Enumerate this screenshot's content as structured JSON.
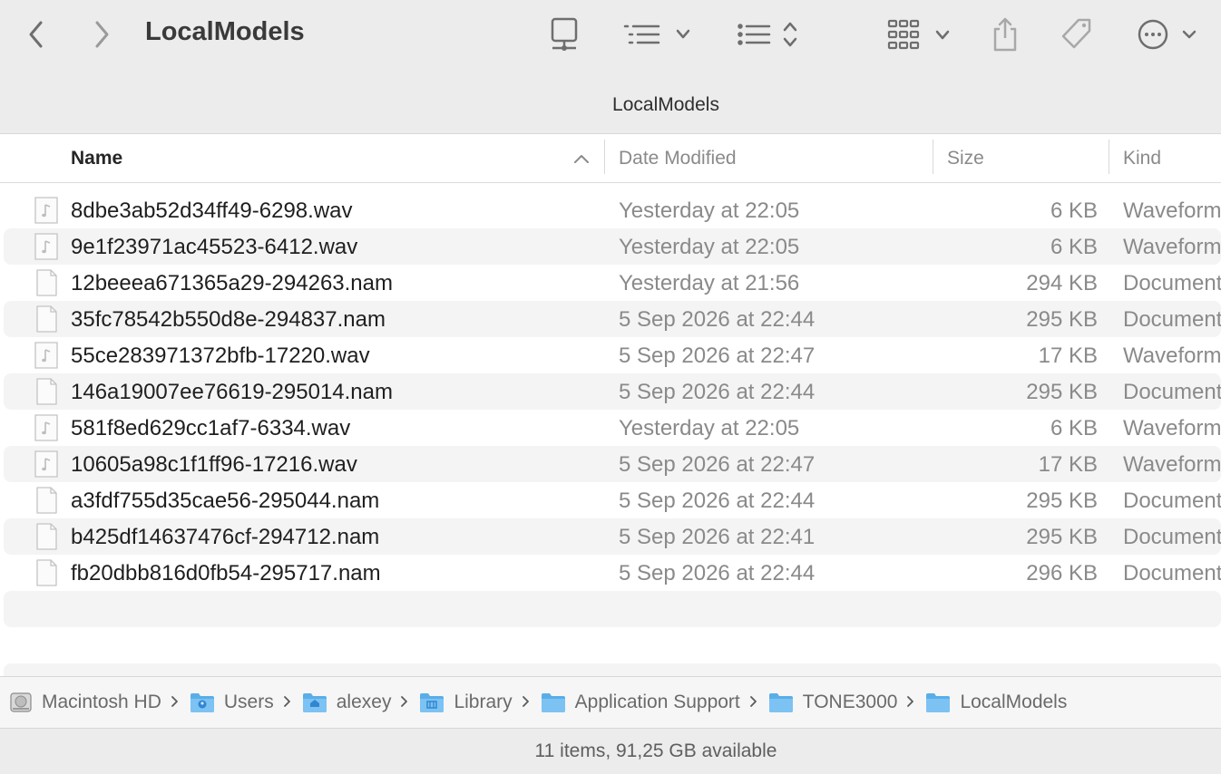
{
  "window": {
    "title": "LocalModels",
    "path_title": "LocalModels"
  },
  "toolbar": {
    "back_icon": "chevron-left-icon",
    "forward_icon": "chevron-right-icon",
    "items": [
      {
        "name": "server-icon"
      },
      {
        "name": "group-menu-icon"
      },
      {
        "name": "view-list-icon"
      },
      {
        "name": "gallery-view-icon"
      },
      {
        "name": "share-icon"
      },
      {
        "name": "tag-icon"
      },
      {
        "name": "more-actions-icon"
      }
    ]
  },
  "columns": {
    "name": "Name",
    "date": "Date Modified",
    "size": "Size",
    "kind": "Kind"
  },
  "files": [
    {
      "name": "8dbe3ab52d34ff49-6298.wav",
      "date": "Yesterday at 22:05",
      "size": "6 KB",
      "kind": "Waveform",
      "type": "audio"
    },
    {
      "name": "9e1f23971ac45523-6412.wav",
      "date": "Yesterday at 22:05",
      "size": "6 KB",
      "kind": "Waveform",
      "type": "audio"
    },
    {
      "name": "12beeea671365a29-294263.nam",
      "date": "Yesterday at 21:56",
      "size": "294 KB",
      "kind": "Document",
      "type": "doc"
    },
    {
      "name": "35fc78542b550d8e-294837.nam",
      "date": "5 Sep 2026 at 22:44",
      "size": "295 KB",
      "kind": "Document",
      "type": "doc"
    },
    {
      "name": "55ce283971372bfb-17220.wav",
      "date": "5 Sep 2026 at 22:47",
      "size": "17 KB",
      "kind": "Waveform",
      "type": "audio"
    },
    {
      "name": "146a19007ee76619-295014.nam",
      "date": "5 Sep 2026 at 22:44",
      "size": "295 KB",
      "kind": "Document",
      "type": "doc"
    },
    {
      "name": "581f8ed629cc1af7-6334.wav",
      "date": "Yesterday at 22:05",
      "size": "6 KB",
      "kind": "Waveform",
      "type": "audio"
    },
    {
      "name": "10605a98c1f1ff96-17216.wav",
      "date": "5 Sep 2026 at 22:47",
      "size": "17 KB",
      "kind": "Waveform",
      "type": "audio"
    },
    {
      "name": "a3fdf755d35cae56-295044.nam",
      "date": "5 Sep 2026 at 22:44",
      "size": "295 KB",
      "kind": "Document",
      "type": "doc"
    },
    {
      "name": "b425df14637476cf-294712.nam",
      "date": "5 Sep 2026 at 22:41",
      "size": "295 KB",
      "kind": "Document",
      "type": "doc"
    },
    {
      "name": "fb20dbb816d0fb54-295717.nam",
      "date": "5 Sep 2026 at 22:44",
      "size": "296 KB",
      "kind": "Document",
      "type": "doc"
    }
  ],
  "pathbar": [
    {
      "label": "Macintosh HD",
      "icon": "hard-drive-icon"
    },
    {
      "label": "Users",
      "icon": "users-folder-icon"
    },
    {
      "label": "alexey",
      "icon": "home-folder-icon"
    },
    {
      "label": "Library",
      "icon": "library-folder-icon"
    },
    {
      "label": "Application Support",
      "icon": "folder-icon"
    },
    {
      "label": "TONE3000",
      "icon": "folder-icon"
    },
    {
      "label": "LocalModels",
      "icon": "folder-icon"
    }
  ],
  "status": {
    "text": "11 items, 91,25 GB available"
  },
  "colors": {
    "folder": "#5aaee8",
    "row_alt": "#f4f4f5",
    "toolbar_bg": "#ececec"
  }
}
